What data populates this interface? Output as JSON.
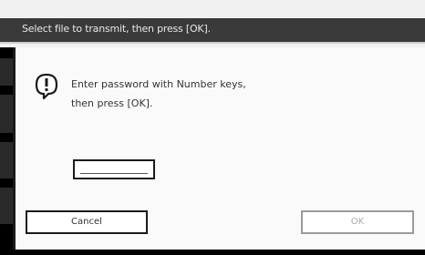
{
  "header": {
    "instruction": "Select file to transmit, then press [OK]."
  },
  "dialog": {
    "icon": "alert-icon",
    "message_line1": "Enter password with Number keys,",
    "message_line2": "then press [OK].",
    "password_value": "",
    "cancel_label": "Cancel",
    "ok_label": "OK"
  }
}
